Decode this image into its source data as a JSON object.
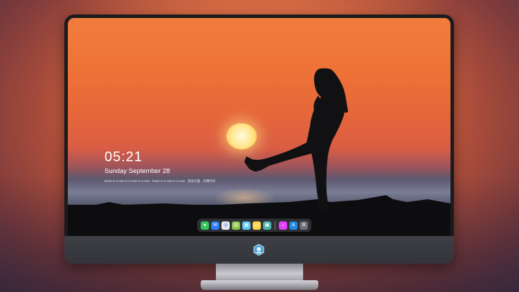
{
  "lock_screen": {
    "time": "05:21",
    "date": "Sunday September  28",
    "tagline": "Rose is a rose is a rose is a rose · Rose is a rose is a rose · 登录页面 · 日期时间"
  },
  "dock": {
    "apps": [
      {
        "name": "messages-icon",
        "color": "#34c759",
        "glyph": "●"
      },
      {
        "name": "mail-icon",
        "color": "#2f7bf6",
        "glyph": "✉"
      },
      {
        "name": "safari-icon",
        "color": "#e8e8ec",
        "glyph": "◎"
      },
      {
        "name": "finder-icon",
        "color": "#8bc34a",
        "glyph": "▤"
      },
      {
        "name": "clapper-icon",
        "color": "#5ac8fa",
        "glyph": "▦"
      },
      {
        "name": "notes-icon",
        "color": "#ffd54f",
        "glyph": "▭"
      },
      {
        "name": "photos-icon",
        "color": "#4db6ac",
        "glyph": "▣"
      },
      {
        "name": "music-icon",
        "color": "#e040fb",
        "glyph": "♪"
      },
      {
        "name": "app-store-icon",
        "color": "#1e88e5",
        "glyph": "A"
      },
      {
        "name": "settings-icon",
        "color": "#6d6d75",
        "glyph": "⚙"
      }
    ]
  },
  "colors": {
    "sky_top": "#f07c3d",
    "sky_horizon": "#d95d45",
    "sun": "#ffe58a",
    "bezel": "#1b1b1e"
  }
}
